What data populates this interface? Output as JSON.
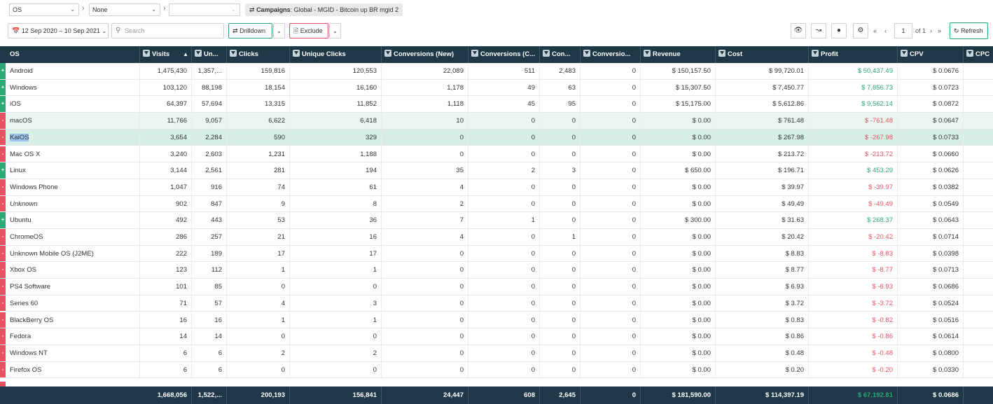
{
  "toolbar1": {
    "group1": "OS",
    "group2": "None",
    "group3": "",
    "crumb_label": "Campaigns",
    "crumb_value": ": Global - MGID - Bitcoin up BR mgid 2"
  },
  "toolbar2": {
    "date_range": "12 Sep 2020 – 10 Sep 2021",
    "search_placeholder": "Search",
    "drilldown_label": "Drilldown",
    "exclude_label": "Exclude",
    "page_value": "1",
    "page_of": "of 1",
    "refresh_label": "Refresh"
  },
  "icons": {
    "calendar": "calendar-icon",
    "search": "search-icon",
    "shuffle": "shuffle-icon",
    "doc": "document-icon",
    "eye": "eye-icon",
    "chart": "line-chart-icon",
    "comment": "comment-icon",
    "gear": "gear-icon",
    "refresh": "refresh-icon"
  },
  "colors": {
    "header": "#1f3847",
    "positive": "#2aa876",
    "negative": "#e8525f",
    "selection": "#d8efe8"
  },
  "headers": [
    "OS",
    "Visits",
    "Un...",
    "Clicks",
    "Unique Clicks",
    "Conversions (New)",
    "Conversions (C...",
    "Con...",
    "Conversio...",
    "Revenue",
    "Cost",
    "Profit",
    "CPV",
    "CPC"
  ],
  "rows": [
    {
      "tag": "+",
      "os": "Android",
      "visits": "1,475,430",
      "uv": "1,357,...",
      "clicks": "159,816",
      "uclicks": "120,553",
      "conv_new": "22,089",
      "conv_c": "511",
      "con": "2,483",
      "convo": "0",
      "revenue": "$ 150,157.50",
      "cost": "$ 99,720.01",
      "profit": "$ 50,437.49",
      "cpv": "$ 0.0676"
    },
    {
      "tag": "+",
      "os": "Windows",
      "visits": "103,120",
      "uv": "88,198",
      "clicks": "18,154",
      "uclicks": "16,160",
      "conv_new": "1,178",
      "conv_c": "49",
      "con": "63",
      "convo": "0",
      "revenue": "$ 15,307.50",
      "cost": "$ 7,450.77",
      "profit": "$ 7,856.73",
      "cpv": "$ 0.0723"
    },
    {
      "tag": "+",
      "os": "iOS",
      "visits": "64,397",
      "uv": "57,694",
      "clicks": "13,315",
      "uclicks": "11,852",
      "conv_new": "1,118",
      "conv_c": "45",
      "con": "95",
      "convo": "0",
      "revenue": "$ 15,175.00",
      "cost": "$ 5,612.86",
      "profit": "$ 9,562.14",
      "cpv": "$ 0.0872"
    },
    {
      "tag": "-",
      "os": "macOS",
      "visits": "11,766",
      "uv": "9,057",
      "clicks": "6,622",
      "uclicks": "6,418",
      "conv_new": "10",
      "conv_c": "0",
      "con": "0",
      "convo": "0",
      "revenue": "$ 0.00",
      "cost": "$ 761.48",
      "profit": "$ -761.48",
      "cpv": "$ 0.0647"
    },
    {
      "tag": "-",
      "os": "KaiOS",
      "visits": "3,654",
      "uv": "2,284",
      "clicks": "590",
      "uclicks": "329",
      "conv_new": "0",
      "conv_c": "0",
      "con": "0",
      "convo": "0",
      "revenue": "$ 0.00",
      "cost": "$ 267.98",
      "profit": "$ -267.98",
      "cpv": "$ 0.0733"
    },
    {
      "tag": "-",
      "os": "Mac OS X",
      "visits": "3,240",
      "uv": "2,603",
      "clicks": "1,231",
      "uclicks": "1,188",
      "conv_new": "0",
      "conv_c": "0",
      "con": "0",
      "convo": "0",
      "revenue": "$ 0.00",
      "cost": "$ 213.72",
      "profit": "$ -213.72",
      "cpv": "$ 0.0660"
    },
    {
      "tag": "+",
      "os": "Linux",
      "visits": "3,144",
      "uv": "2,561",
      "clicks": "281",
      "uclicks": "194",
      "conv_new": "35",
      "conv_c": "2",
      "con": "3",
      "convo": "0",
      "revenue": "$ 650.00",
      "cost": "$ 196.71",
      "profit": "$ 453.29",
      "cpv": "$ 0.0626"
    },
    {
      "tag": "-",
      "os": "Windows Phone",
      "visits": "1,047",
      "uv": "916",
      "clicks": "74",
      "uclicks": "61",
      "conv_new": "4",
      "conv_c": "0",
      "con": "0",
      "convo": "0",
      "revenue": "$ 0.00",
      "cost": "$ 39.97",
      "profit": "$ -39.97",
      "cpv": "$ 0.0382"
    },
    {
      "tag": "-",
      "os": "Unknown",
      "visits": "902",
      "uv": "847",
      "clicks": "9",
      "uclicks": "8",
      "conv_new": "2",
      "conv_c": "0",
      "con": "0",
      "convo": "0",
      "revenue": "$ 0.00",
      "cost": "$ 49.49",
      "profit": "$ -49.49",
      "cpv": "$ 0.0549"
    },
    {
      "tag": "+",
      "os": "Ubuntu",
      "visits": "492",
      "uv": "443",
      "clicks": "53",
      "uclicks": "36",
      "conv_new": "7",
      "conv_c": "1",
      "con": "0",
      "convo": "0",
      "revenue": "$ 300.00",
      "cost": "$ 31.63",
      "profit": "$ 268.37",
      "cpv": "$ 0.0643"
    },
    {
      "tag": "-",
      "os": "ChromeOS",
      "visits": "286",
      "uv": "257",
      "clicks": "21",
      "uclicks": "16",
      "conv_new": "4",
      "conv_c": "0",
      "con": "1",
      "convo": "0",
      "revenue": "$ 0.00",
      "cost": "$ 20.42",
      "profit": "$ -20.42",
      "cpv": "$ 0.0714"
    },
    {
      "tag": "-",
      "os": "Unknown Mobile OS (J2ME)",
      "visits": "222",
      "uv": "189",
      "clicks": "17",
      "uclicks": "17",
      "conv_new": "0",
      "conv_c": "0",
      "con": "0",
      "convo": "0",
      "revenue": "$ 0.00",
      "cost": "$ 8.83",
      "profit": "$ -8.83",
      "cpv": "$ 0.0398"
    },
    {
      "tag": "-",
      "os": "Xbox OS",
      "visits": "123",
      "uv": "112",
      "clicks": "1",
      "uclicks": "1",
      "conv_new": "0",
      "conv_c": "0",
      "con": "0",
      "convo": "0",
      "revenue": "$ 0.00",
      "cost": "$ 8.77",
      "profit": "$ -8.77",
      "cpv": "$ 0.0713"
    },
    {
      "tag": "-",
      "os": "PS4 Software",
      "visits": "101",
      "uv": "85",
      "clicks": "0",
      "uclicks": "0",
      "conv_new": "0",
      "conv_c": "0",
      "con": "0",
      "convo": "0",
      "revenue": "$ 0.00",
      "cost": "$ 6.93",
      "profit": "$ -6.93",
      "cpv": "$ 0.0686"
    },
    {
      "tag": "-",
      "os": "Series 60",
      "visits": "71",
      "uv": "57",
      "clicks": "4",
      "uclicks": "3",
      "conv_new": "0",
      "conv_c": "0",
      "con": "0",
      "convo": "0",
      "revenue": "$ 0.00",
      "cost": "$ 3.72",
      "profit": "$ -3.72",
      "cpv": "$ 0.0524"
    },
    {
      "tag": "-",
      "os": "BlackBerry OS",
      "visits": "16",
      "uv": "16",
      "clicks": "1",
      "uclicks": "1",
      "conv_new": "0",
      "conv_c": "0",
      "con": "0",
      "convo": "0",
      "revenue": "$ 0.00",
      "cost": "$ 0.83",
      "profit": "$ -0.82",
      "cpv": "$ 0.0516"
    },
    {
      "tag": "-",
      "os": "Fedora",
      "visits": "14",
      "uv": "14",
      "clicks": "0",
      "uclicks": "0",
      "conv_new": "0",
      "conv_c": "0",
      "con": "0",
      "convo": "0",
      "revenue": "$ 0.00",
      "cost": "$ 0.86",
      "profit": "$ -0.86",
      "cpv": "$ 0.0614"
    },
    {
      "tag": "-",
      "os": "Windows NT",
      "visits": "6",
      "uv": "6",
      "clicks": "2",
      "uclicks": "2",
      "conv_new": "0",
      "conv_c": "0",
      "con": "0",
      "convo": "0",
      "revenue": "$ 0.00",
      "cost": "$ 0.48",
      "profit": "$ -0.48",
      "cpv": "$ 0.0800"
    },
    {
      "tag": "-",
      "os": "Firefox OS",
      "visits": "6",
      "uv": "6",
      "clicks": "0",
      "uclicks": "0",
      "conv_new": "0",
      "conv_c": "0",
      "con": "0",
      "convo": "0",
      "revenue": "$ 0.00",
      "cost": "$ 0.20",
      "profit": "$ -0.20",
      "cpv": "$ 0.0330"
    }
  ],
  "footer": {
    "visits": "1,668,056",
    "uv": "1,522,...",
    "clicks": "200,193",
    "uclicks": "156,841",
    "conv_new": "24,447",
    "conv_c": "608",
    "con": "2,645",
    "convo": "0",
    "revenue": "$ 181,590.00",
    "cost": "$ 114,397.19",
    "profit": "$ 67,192.81",
    "cpv": "$ 0.0686"
  }
}
